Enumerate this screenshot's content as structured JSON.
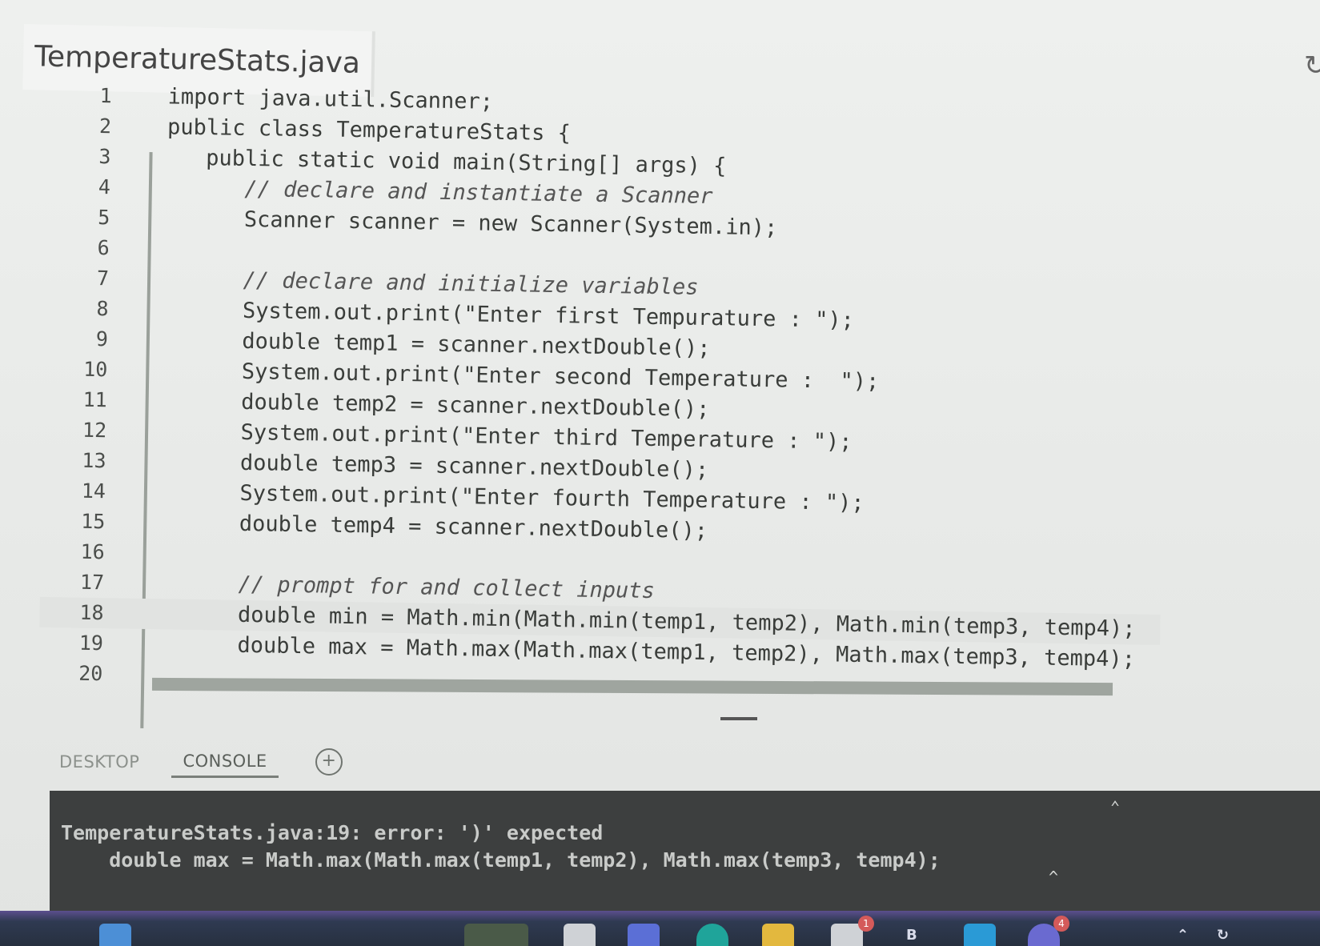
{
  "editor": {
    "file_tab": "TemperatureStats.java",
    "lines": [
      {
        "no": "1",
        "text": "import java.util.Scanner;",
        "comment": false
      },
      {
        "no": "2",
        "text": "public class TemperatureStats {",
        "comment": false
      },
      {
        "no": "3",
        "text": "   public static void main(String[] args) {",
        "comment": false
      },
      {
        "no": "4",
        "text": "      // declare and instantiate a Scanner",
        "comment": true
      },
      {
        "no": "5",
        "text": "      Scanner scanner = new Scanner(System.in);",
        "comment": false
      },
      {
        "no": "6",
        "text": "",
        "comment": false
      },
      {
        "no": "7",
        "text": "      // declare and initialize variables",
        "comment": true
      },
      {
        "no": "8",
        "text": "      System.out.print(\"Enter first Tempurature : \");",
        "comment": false
      },
      {
        "no": "9",
        "text": "      double temp1 = scanner.nextDouble();",
        "comment": false
      },
      {
        "no": "10",
        "text": "      System.out.print(\"Enter second Temperature :  \");",
        "comment": false
      },
      {
        "no": "11",
        "text": "      double temp2 = scanner.nextDouble();",
        "comment": false
      },
      {
        "no": "12",
        "text": "      System.out.print(\"Enter third Temperature : \");",
        "comment": false
      },
      {
        "no": "13",
        "text": "      double temp3 = scanner.nextDouble();",
        "comment": false
      },
      {
        "no": "14",
        "text": "      System.out.print(\"Enter fourth Temperature : \");",
        "comment": false
      },
      {
        "no": "15",
        "text": "      double temp4 = scanner.nextDouble();",
        "comment": false
      },
      {
        "no": "16",
        "text": "",
        "comment": false
      },
      {
        "no": "17",
        "text": "      // prompt for and collect inputs",
        "comment": true
      },
      {
        "no": "18",
        "text": "      double min = Math.min(Math.min(temp1, temp2), Math.min(temp3, temp4);",
        "comment": false
      },
      {
        "no": "19",
        "text": "      double max = Math.max(Math.max(temp1, temp2), Math.max(temp3, temp4);",
        "comment": false
      },
      {
        "no": "20",
        "text": "",
        "comment": false
      }
    ]
  },
  "console_tabs": {
    "desktop": "DESKTOP",
    "console": "CONSOLE",
    "add_icon": "+"
  },
  "console": {
    "error_line": "TemperatureStats.java:19: error: ')' expected",
    "source_line": "    double max = Math.max(Math.max(temp1, temp2), Math.max(temp3, temp4);",
    "caret": "^"
  },
  "taskbar": {
    "badges": [
      "1",
      "4"
    ],
    "label_b": "B"
  },
  "colors": {
    "console_bg": "#3d3f3f",
    "console_text": "#c9cbc9",
    "taskbar": "#27303f",
    "badge": "#d45a5a"
  }
}
